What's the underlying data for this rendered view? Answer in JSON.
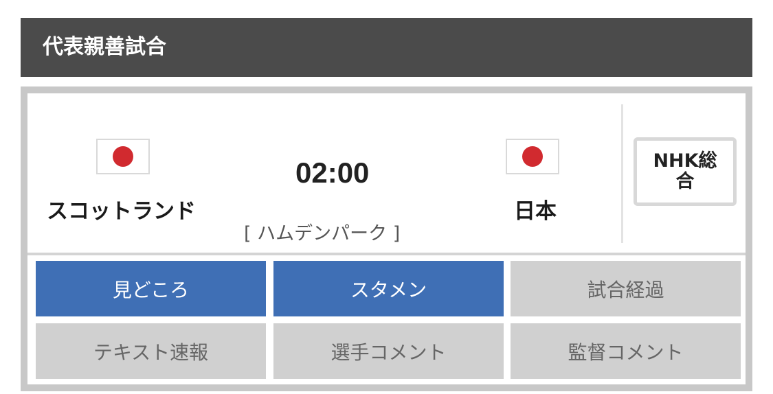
{
  "header": {
    "title": "代表親善試合"
  },
  "match": {
    "home": {
      "name": "スコットランド",
      "flag": "japan-flag"
    },
    "away": {
      "name": "日本",
      "flag": "japan-flag"
    },
    "time": "02:00",
    "venue": "[ ハムデンパーク ]",
    "channel": "NHK総合"
  },
  "tabs": [
    {
      "label": "見どころ",
      "active": true
    },
    {
      "label": "スタメン",
      "active": true
    },
    {
      "label": "試合経過",
      "active": false
    },
    {
      "label": "テキスト速報",
      "active": false
    },
    {
      "label": "選手コメント",
      "active": false
    },
    {
      "label": "監督コメント",
      "active": false
    }
  ],
  "colors": {
    "header_bg": "#4b4b4b",
    "tab_active": "#3f6fb5",
    "tab_inactive": "#d0d0d0",
    "flag_disc": "#d12a2f"
  }
}
